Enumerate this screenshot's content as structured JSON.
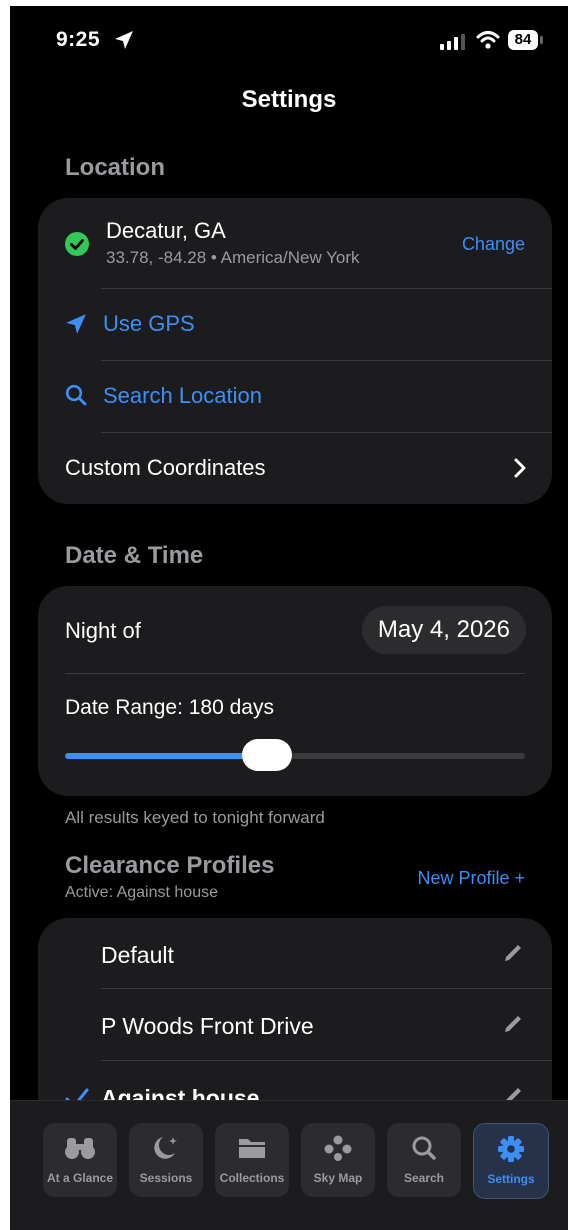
{
  "status_bar": {
    "time": "9:25",
    "battery": "84"
  },
  "nav": {
    "title": "Settings"
  },
  "location": {
    "section_title": "Location",
    "place_name": "Decatur, GA",
    "place_detail": "33.78, -84.28 • America/New York",
    "change_label": "Change",
    "use_gps_label": "Use GPS",
    "search_location_label": "Search Location",
    "custom_coordinates_label": "Custom Coordinates"
  },
  "date_time": {
    "section_title": "Date & Time",
    "night_of_label": "Night of",
    "night_of_value": "May 4, 2026",
    "date_range_label": "Date Range: 180 days",
    "slider_fraction": 0.44,
    "footnote": "All results keyed to tonight forward"
  },
  "clearance": {
    "section_title": "Clearance Profiles",
    "active_label": "Active: Against house",
    "new_profile_label": "New Profile +",
    "profiles": [
      {
        "name": "Default"
      },
      {
        "name": "P Woods Front Drive"
      },
      {
        "name": "Against house"
      }
    ]
  },
  "tab_bar": {
    "tabs": [
      {
        "label": "At a Glance",
        "icon": "binoculars-icon"
      },
      {
        "label": "Sessions",
        "icon": "moon-stars-icon"
      },
      {
        "label": "Collections",
        "icon": "folder-icon"
      },
      {
        "label": "Sky Map",
        "icon": "constellation-icon"
      },
      {
        "label": "Search",
        "icon": "magnifier-icon"
      },
      {
        "label": "Settings",
        "icon": "gear-icon"
      }
    ],
    "active": "Settings"
  },
  "colors": {
    "accent": "#3d8ef5",
    "success": "#34c759",
    "background": "#000000",
    "card": "#1c1c1e"
  }
}
